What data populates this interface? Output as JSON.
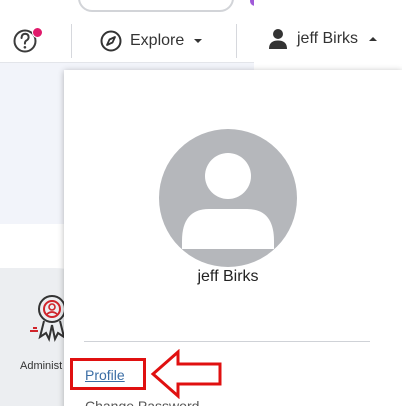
{
  "header": {
    "explore_label": "Explore",
    "user_name": "jeff Birks"
  },
  "background": {
    "admin_tile_label": "Administ"
  },
  "user_menu": {
    "display_name": "jeff Birks",
    "items": [
      {
        "label": "Profile"
      },
      {
        "label": "Change Password"
      }
    ]
  },
  "colors": {
    "notification": "#e01a6b",
    "link": "#3b6ea5",
    "annotation": "#e01010",
    "avatar": "#b5b7bb"
  },
  "icons": {
    "help": "help-circle-icon",
    "explore": "compass-icon",
    "user": "user-icon",
    "admin": "admin-badge-icon"
  }
}
